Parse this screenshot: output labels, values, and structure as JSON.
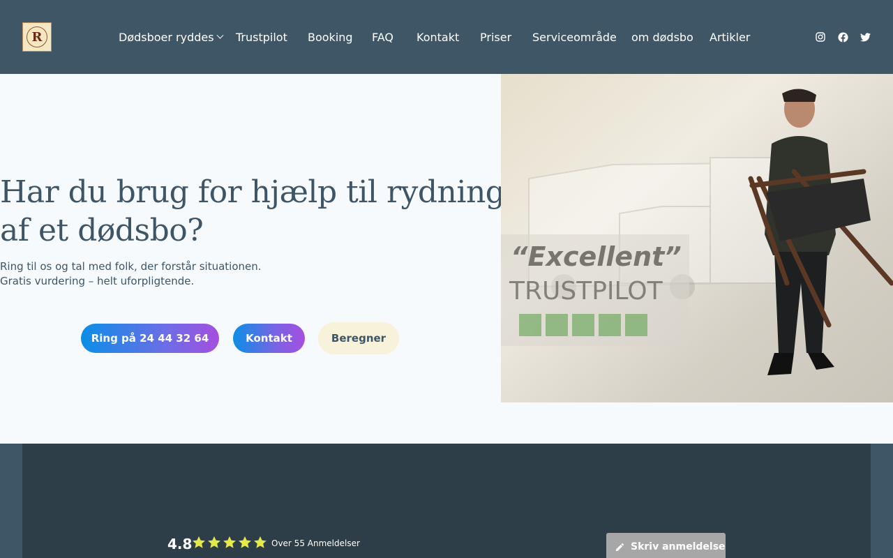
{
  "header": {
    "logo_letter": "R",
    "nav": [
      {
        "label": "Dødsboer ryddes",
        "has_dropdown": true
      },
      {
        "label": "Trustpilot"
      },
      {
        "label": "Booking"
      },
      {
        "label": "FAQ"
      },
      {
        "label": "Kontakt"
      },
      {
        "label": "Priser"
      },
      {
        "label": "Serviceområde"
      },
      {
        "label": "om dødsbo"
      },
      {
        "label": "Artikler"
      }
    ],
    "social_icons": [
      "instagram-icon",
      "facebook-icon",
      "twitter-icon"
    ]
  },
  "hero": {
    "title_line1": "Har du brug for hjælp til rydning",
    "title_line2": "af et dødsbo?",
    "sub_line1": "Ring til os og tal med folk, der forstår situationen.",
    "sub_line2": "Gratis vurdering – helt uforpligtende.",
    "btn_call": "Ring på 24 44 32 64",
    "btn_contact": "Kontakt",
    "btn_calc": "Beregner",
    "image": {
      "sign_text1": "“Excellent”",
      "sign_text2": "TRUSTPILOT"
    }
  },
  "reviews": {
    "rating": "4.8",
    "stars": 4.8,
    "count_label": "Over 55 Anmeldelser",
    "write_label": "Skriv anmeldelse"
  },
  "colors": {
    "header_bg": "#3f5666",
    "page_bg": "#f7fafd",
    "text": "#3d5566",
    "star": "#e5e94a",
    "band_bg": "#2e3e48"
  }
}
